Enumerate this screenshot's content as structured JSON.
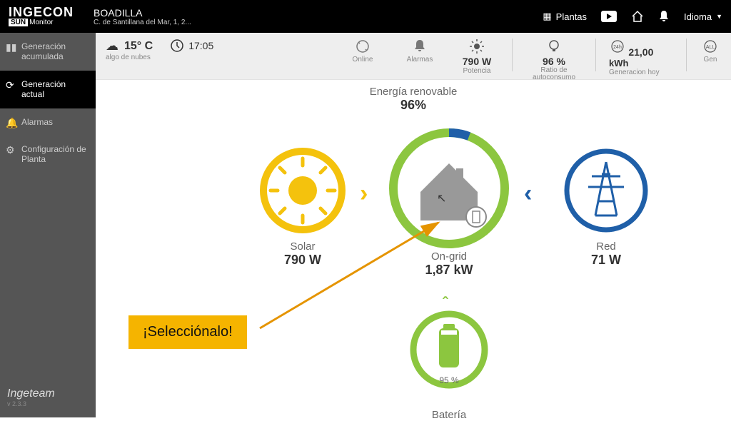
{
  "brand": {
    "line1": "INGECON",
    "sun": "SUN",
    "monitor": "Monitor"
  },
  "location": {
    "name": "BOADILLA",
    "address": "C. de Santillana del Mar, 1, 2..."
  },
  "topnav": {
    "plantas": "Plantas",
    "idioma": "Idioma"
  },
  "sidebar": {
    "items": [
      {
        "label": "Generación acumulada"
      },
      {
        "label": "Generación actual"
      },
      {
        "label": "Alarmas"
      },
      {
        "label": "Configuración de Planta"
      }
    ],
    "footer": "Ingeteam",
    "version": "v 2.3.3"
  },
  "status": {
    "temp": "15° C",
    "weather_text": "algo de nubes",
    "time": "17:05",
    "online": "Online",
    "alarmas": "Alarmas",
    "potencia_label": "Potencia",
    "potencia_val": "790 W",
    "ratio_label": "Ratio de autoconsumo",
    "ratio_val": "96 %",
    "genhoy_label": "Generacion hoy",
    "genhoy_val": "21,00",
    "genhoy_unit": "kWh",
    "gen_cut": "Gen"
  },
  "diagram": {
    "renew_label": "Energía renovable",
    "renew_pct": "96%",
    "solar_label": "Solar",
    "solar_val": "790 W",
    "house_label": "On-grid",
    "house_val": "1,87 kW",
    "grid_label": "Red",
    "grid_val": "71 W",
    "batt_label": "Batería",
    "batt_pct": "95 %"
  },
  "callout": "¡Selecciónalo!"
}
